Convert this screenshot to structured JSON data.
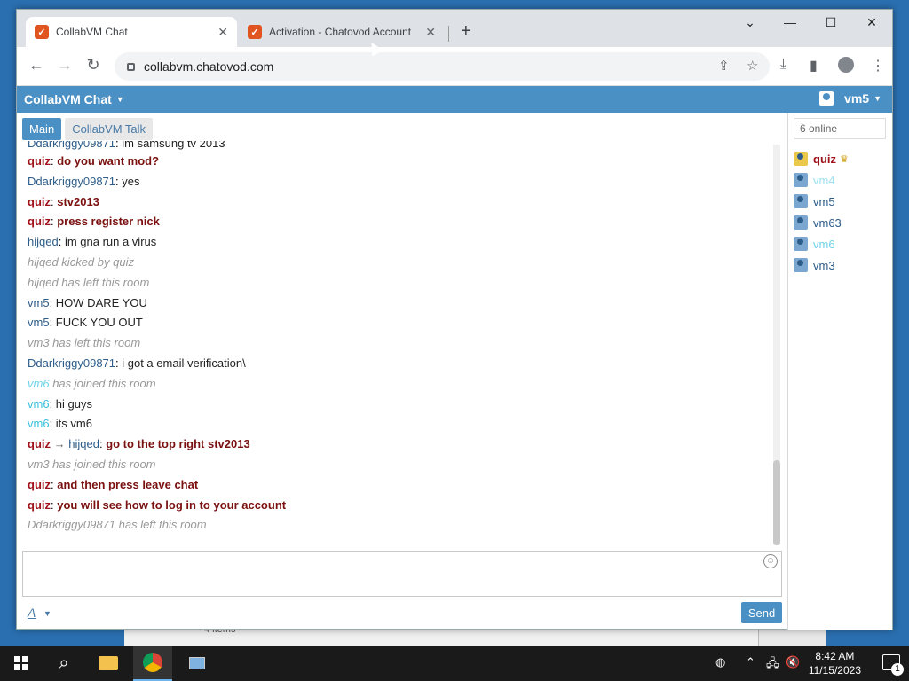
{
  "browser": {
    "tabs": [
      {
        "title": "CollabVM Chat",
        "active": true
      },
      {
        "title": "Activation - Chatovod Account",
        "active": false
      }
    ],
    "new_tab_label": "+",
    "url": "collabvm.chatovod.com"
  },
  "app": {
    "title": "CollabVM Chat",
    "current_user": "vm5",
    "chat_tabs": [
      {
        "label": "Main",
        "active": true
      },
      {
        "label": "CollabVM Talk",
        "active": false
      }
    ],
    "send_label": "Send",
    "format_label": "A",
    "online_count": "6 online"
  },
  "messages": [
    {
      "type": "msg",
      "user": "Ddarkriggy09871",
      "user_color": "#2d5d8a",
      "text": "im samsung tv 2013",
      "text_color": "#222222",
      "bold": false,
      "cut": true
    },
    {
      "type": "msg",
      "user": "quiz",
      "user_color": "#a0121b",
      "text": "do you want mod?",
      "text_color": "#7a1010",
      "bold": true
    },
    {
      "type": "msg",
      "user": "Ddarkriggy09871",
      "user_color": "#2d5d8a",
      "text": "yes",
      "text_color": "#222222",
      "bold": false
    },
    {
      "type": "msg",
      "user": "quiz",
      "user_color": "#a0121b",
      "text": "stv2013",
      "text_color": "#7a1010",
      "bold": true
    },
    {
      "type": "msg",
      "user": "quiz",
      "user_color": "#a0121b",
      "text": "press register nick",
      "text_color": "#7a1010",
      "bold": true
    },
    {
      "type": "msg",
      "user": "hijqed",
      "user_color": "#2d5d8a",
      "text": "im gna run a virus",
      "text_color": "#222222",
      "bold": false
    },
    {
      "type": "event",
      "text": "hijqed kicked by quiz"
    },
    {
      "type": "event",
      "text": "hijqed has left this room"
    },
    {
      "type": "msg",
      "user": "vm5",
      "user_color": "#2d5d8a",
      "text": "HOW DARE YOU",
      "text_color": "#222222",
      "bold": false
    },
    {
      "type": "msg",
      "user": "vm5",
      "user_color": "#2d5d8a",
      "text": "FUCK YOU OUT",
      "text_color": "#222222",
      "bold": false
    },
    {
      "type": "event",
      "text": "vm3 has left this room"
    },
    {
      "type": "msg",
      "user": "Ddarkriggy09871",
      "user_color": "#2d5d8a",
      "text": "i got a email verification\\",
      "text_color": "#222222",
      "bold": false
    },
    {
      "type": "event_user",
      "user": "vm6",
      "user_color": "#6fd3e8",
      "text": "has joined this room"
    },
    {
      "type": "msg",
      "user": "vm6",
      "user_color": "#3ac1dc",
      "text": "hi guys",
      "text_color": "#222222",
      "bold": false
    },
    {
      "type": "msg",
      "user": "vm6",
      "user_color": "#3ac1dc",
      "text": "its vm6",
      "text_color": "#222222",
      "bold": false
    },
    {
      "type": "private",
      "user": "quiz",
      "user_color": "#a0121b",
      "arrow": "→",
      "to": "hijqed",
      "to_color": "#2d5d8a",
      "text": "go to the top right stv2013",
      "text_color": "#7a1010"
    },
    {
      "type": "event",
      "text": "vm3 has joined this room"
    },
    {
      "type": "msg",
      "user": "quiz",
      "user_color": "#a0121b",
      "text": "and then press leave chat",
      "text_color": "#7a1010",
      "bold": true
    },
    {
      "type": "msg",
      "user": "quiz",
      "user_color": "#a0121b",
      "text": "you will see how to log in to your account",
      "text_color": "#7a1010",
      "bold": true
    },
    {
      "type": "event",
      "text": "Ddarkriggy09871 has left this room"
    }
  ],
  "users": [
    {
      "name": "quiz",
      "color": "#a0121b",
      "bold": true,
      "icon": "gold",
      "crown": true
    },
    {
      "name": "vm4",
      "color": "#9fe0ef",
      "bold": false,
      "icon": "blue",
      "crown": false
    },
    {
      "name": "vm5",
      "color": "#2d5d8a",
      "bold": false,
      "icon": "blue",
      "crown": false
    },
    {
      "name": "vm63",
      "color": "#2d5d8a",
      "bold": false,
      "icon": "blue",
      "crown": false
    },
    {
      "name": "vm6",
      "color": "#6fd3e8",
      "bold": false,
      "icon": "blue",
      "crown": false
    },
    {
      "name": "vm3",
      "color": "#2d5d8a",
      "bold": false,
      "icon": "blue",
      "crown": false
    }
  ],
  "taskbar": {
    "time": "8:42 AM",
    "date": "11/15/2023",
    "notification_count": "1",
    "bg_window_status": "4 items"
  },
  "colors": {
    "accent": "#4a90c4",
    "event_text": "#999999"
  }
}
